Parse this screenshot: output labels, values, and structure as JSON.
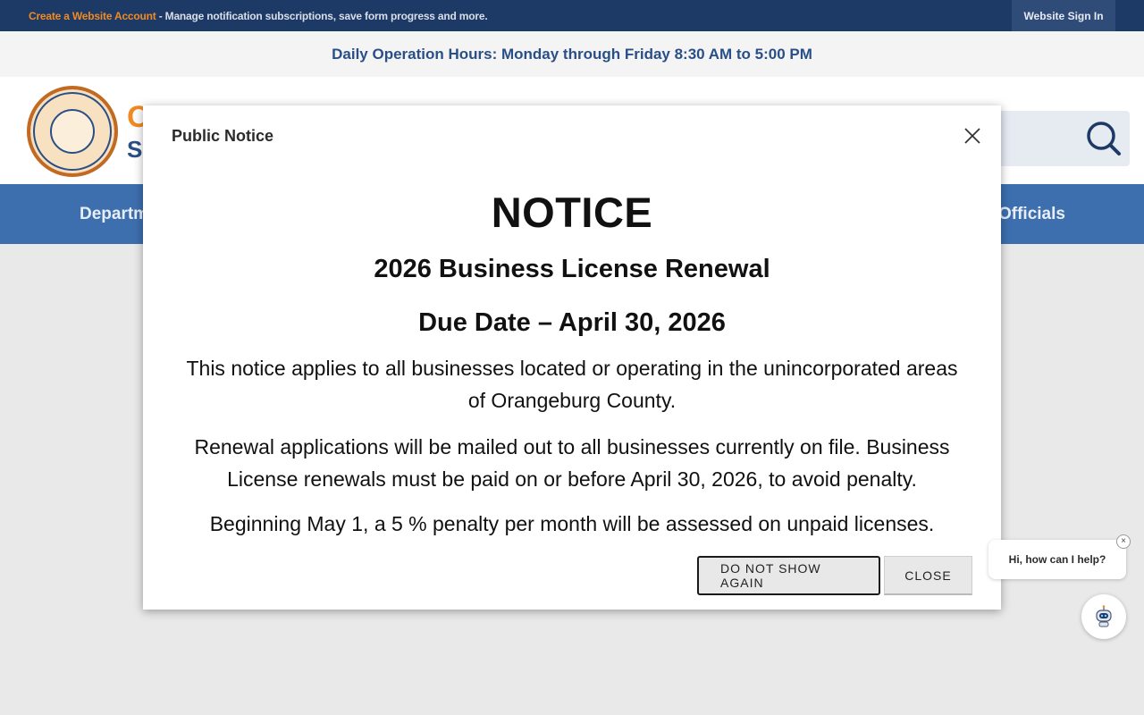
{
  "topbar": {
    "create_account_link": "Create a Website Account",
    "message": " - Manage notification subscriptions, save form progress and more.",
    "sign_in": "Website Sign In"
  },
  "hours": {
    "text": "Daily Operation Hours: Monday through Friday 8:30 AM to 5:00 PM"
  },
  "header": {
    "brand_line1_partial": "O",
    "brand_line2_partial": "S"
  },
  "nav": {
    "left_partial": "Departm",
    "right_partial": "Officials"
  },
  "modal": {
    "title": "Public Notice",
    "heading": "NOTICE",
    "subheading": "2026 Business License Renewal",
    "due_date": "Due Date – April 30, 2026",
    "paragraph1": "This notice applies to all businesses located or operating in the unincorporated areas of Orangeburg County.",
    "paragraph2": "Renewal applications will be mailed out to all businesses currently on file. Business License renewals must be paid on or before April 30, 2026, to avoid penalty.",
    "paragraph3": "Beginning May 1, a 5 % penalty per month will be assessed on unpaid licenses.",
    "do_not_show_label": "DO NOT SHOW AGAIN",
    "close_label": "CLOSE"
  },
  "chat": {
    "prompt": "Hi, how can I help?",
    "dismiss": "×"
  },
  "colors": {
    "topbar_bg": "#1d3a66",
    "accent_orange": "#f08a24",
    "nav_bg": "#3d6fae",
    "hours_text": "#2a4f86"
  }
}
